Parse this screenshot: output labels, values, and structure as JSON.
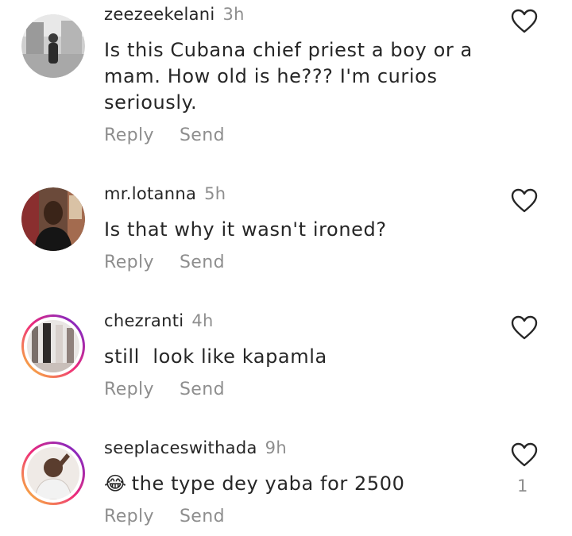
{
  "comments": [
    {
      "username": "zeezeekelani",
      "time": "3h",
      "text": "Is this Cubana chief priest a boy or a mam. How old is he??? I'm curios seriously.",
      "reply_label": "Reply",
      "send_label": "Send"
    },
    {
      "username": "mr.lotanna",
      "time": "5h",
      "text": "Is that why it wasn't ironed?",
      "reply_label": "Reply",
      "send_label": "Send"
    },
    {
      "username": "chezranti",
      "time": "4h",
      "text": "still  look like kapamla",
      "reply_label": "Reply",
      "send_label": "Send"
    },
    {
      "username": "seeplaceswithada",
      "time": "9h",
      "emoji": "😂",
      "text": "the type dey yaba for 2500",
      "reply_label": "Reply",
      "send_label": "Send",
      "like_count": "1"
    }
  ],
  "icons": {
    "like": "heart-outline-icon"
  },
  "colors": {
    "text": "#262626",
    "secondary": "#8e8e8e"
  }
}
